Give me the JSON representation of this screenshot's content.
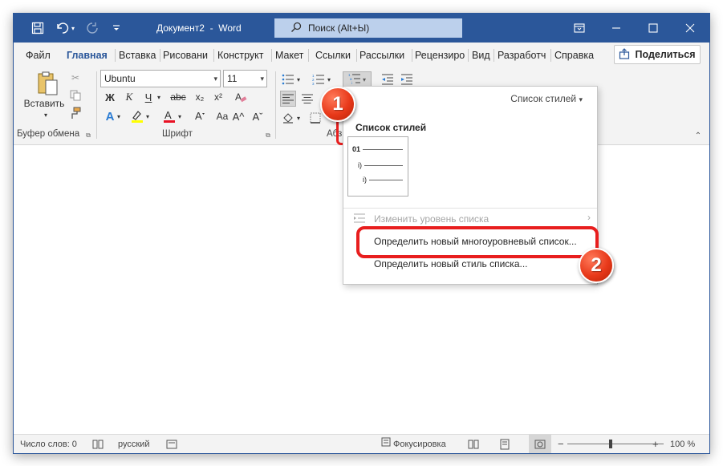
{
  "window": {
    "doc_title": "Документ2",
    "title_sep": "-",
    "app_name": "Word",
    "search_placeholder": "Поиск (Alt+Ы)"
  },
  "tabs": [
    "Файл",
    "Главная",
    "Вставка",
    "Рисовани",
    "Конструкт",
    "Макет",
    "Ссылки",
    "Рассылки",
    "Рецензиро",
    "Вид",
    "Разработч",
    "Справка"
  ],
  "share_label": "Поделиться",
  "ribbon": {
    "paste_label": "Вставить",
    "font_name": "Ubuntu",
    "font_size": "11",
    "bold": "Ж",
    "italic": "К",
    "underline": "Ч",
    "strike": "abc",
    "subscript": "x₂",
    "superscript": "x²",
    "big_a": "A",
    "grow_font": "A^",
    "shrink_font": "Aˇ",
    "case": "Aa",
    "clear_format": "A",
    "group_clipboard": "Буфер обмена",
    "group_font": "Шрифт",
    "group_paragraph": "Абз"
  },
  "dropdown": {
    "header": "Список стилей",
    "section_title": "Список стилей",
    "thumb": {
      "level1": "01",
      "level2": "i)",
      "level3": "i)"
    },
    "item_change_level": "Изменить уровень списка",
    "item_define_multilevel": "Определить новый многоуровневый список...",
    "item_define_style": "Определить новый стиль списка..."
  },
  "badges": {
    "first": "1",
    "second": "2"
  },
  "status": {
    "word_count": "Число слов: 0",
    "language": "русский",
    "focus": "Фокусировка",
    "zoom_level": "100 %"
  },
  "colors": {
    "accent": "#2b579a",
    "annotation_red": "#e81e1e",
    "highlight_yellow": "#ffff00",
    "font_red": "#e81123"
  }
}
